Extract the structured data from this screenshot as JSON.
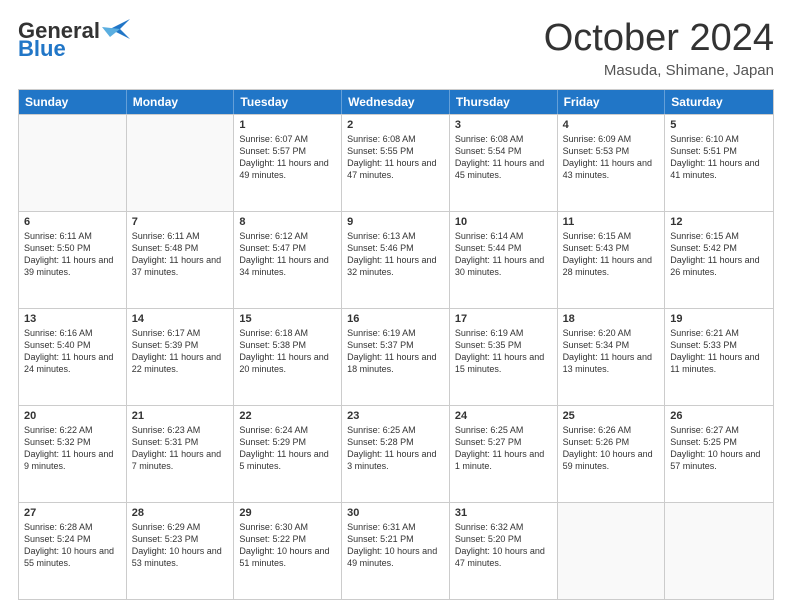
{
  "header": {
    "logo_line1": "General",
    "logo_line2": "Blue",
    "month": "October 2024",
    "location": "Masuda, Shimane, Japan"
  },
  "calendar": {
    "weekdays": [
      "Sunday",
      "Monday",
      "Tuesday",
      "Wednesday",
      "Thursday",
      "Friday",
      "Saturday"
    ],
    "rows": [
      [
        {
          "day": "",
          "info": ""
        },
        {
          "day": "",
          "info": ""
        },
        {
          "day": "1",
          "info": "Sunrise: 6:07 AM\nSunset: 5:57 PM\nDaylight: 11 hours and 49 minutes."
        },
        {
          "day": "2",
          "info": "Sunrise: 6:08 AM\nSunset: 5:55 PM\nDaylight: 11 hours and 47 minutes."
        },
        {
          "day": "3",
          "info": "Sunrise: 6:08 AM\nSunset: 5:54 PM\nDaylight: 11 hours and 45 minutes."
        },
        {
          "day": "4",
          "info": "Sunrise: 6:09 AM\nSunset: 5:53 PM\nDaylight: 11 hours and 43 minutes."
        },
        {
          "day": "5",
          "info": "Sunrise: 6:10 AM\nSunset: 5:51 PM\nDaylight: 11 hours and 41 minutes."
        }
      ],
      [
        {
          "day": "6",
          "info": "Sunrise: 6:11 AM\nSunset: 5:50 PM\nDaylight: 11 hours and 39 minutes."
        },
        {
          "day": "7",
          "info": "Sunrise: 6:11 AM\nSunset: 5:48 PM\nDaylight: 11 hours and 37 minutes."
        },
        {
          "day": "8",
          "info": "Sunrise: 6:12 AM\nSunset: 5:47 PM\nDaylight: 11 hours and 34 minutes."
        },
        {
          "day": "9",
          "info": "Sunrise: 6:13 AM\nSunset: 5:46 PM\nDaylight: 11 hours and 32 minutes."
        },
        {
          "day": "10",
          "info": "Sunrise: 6:14 AM\nSunset: 5:44 PM\nDaylight: 11 hours and 30 minutes."
        },
        {
          "day": "11",
          "info": "Sunrise: 6:15 AM\nSunset: 5:43 PM\nDaylight: 11 hours and 28 minutes."
        },
        {
          "day": "12",
          "info": "Sunrise: 6:15 AM\nSunset: 5:42 PM\nDaylight: 11 hours and 26 minutes."
        }
      ],
      [
        {
          "day": "13",
          "info": "Sunrise: 6:16 AM\nSunset: 5:40 PM\nDaylight: 11 hours and 24 minutes."
        },
        {
          "day": "14",
          "info": "Sunrise: 6:17 AM\nSunset: 5:39 PM\nDaylight: 11 hours and 22 minutes."
        },
        {
          "day": "15",
          "info": "Sunrise: 6:18 AM\nSunset: 5:38 PM\nDaylight: 11 hours and 20 minutes."
        },
        {
          "day": "16",
          "info": "Sunrise: 6:19 AM\nSunset: 5:37 PM\nDaylight: 11 hours and 18 minutes."
        },
        {
          "day": "17",
          "info": "Sunrise: 6:19 AM\nSunset: 5:35 PM\nDaylight: 11 hours and 15 minutes."
        },
        {
          "day": "18",
          "info": "Sunrise: 6:20 AM\nSunset: 5:34 PM\nDaylight: 11 hours and 13 minutes."
        },
        {
          "day": "19",
          "info": "Sunrise: 6:21 AM\nSunset: 5:33 PM\nDaylight: 11 hours and 11 minutes."
        }
      ],
      [
        {
          "day": "20",
          "info": "Sunrise: 6:22 AM\nSunset: 5:32 PM\nDaylight: 11 hours and 9 minutes."
        },
        {
          "day": "21",
          "info": "Sunrise: 6:23 AM\nSunset: 5:31 PM\nDaylight: 11 hours and 7 minutes."
        },
        {
          "day": "22",
          "info": "Sunrise: 6:24 AM\nSunset: 5:29 PM\nDaylight: 11 hours and 5 minutes."
        },
        {
          "day": "23",
          "info": "Sunrise: 6:25 AM\nSunset: 5:28 PM\nDaylight: 11 hours and 3 minutes."
        },
        {
          "day": "24",
          "info": "Sunrise: 6:25 AM\nSunset: 5:27 PM\nDaylight: 11 hours and 1 minute."
        },
        {
          "day": "25",
          "info": "Sunrise: 6:26 AM\nSunset: 5:26 PM\nDaylight: 10 hours and 59 minutes."
        },
        {
          "day": "26",
          "info": "Sunrise: 6:27 AM\nSunset: 5:25 PM\nDaylight: 10 hours and 57 minutes."
        }
      ],
      [
        {
          "day": "27",
          "info": "Sunrise: 6:28 AM\nSunset: 5:24 PM\nDaylight: 10 hours and 55 minutes."
        },
        {
          "day": "28",
          "info": "Sunrise: 6:29 AM\nSunset: 5:23 PM\nDaylight: 10 hours and 53 minutes."
        },
        {
          "day": "29",
          "info": "Sunrise: 6:30 AM\nSunset: 5:22 PM\nDaylight: 10 hours and 51 minutes."
        },
        {
          "day": "30",
          "info": "Sunrise: 6:31 AM\nSunset: 5:21 PM\nDaylight: 10 hours and 49 minutes."
        },
        {
          "day": "31",
          "info": "Sunrise: 6:32 AM\nSunset: 5:20 PM\nDaylight: 10 hours and 47 minutes."
        },
        {
          "day": "",
          "info": ""
        },
        {
          "day": "",
          "info": ""
        }
      ]
    ]
  }
}
